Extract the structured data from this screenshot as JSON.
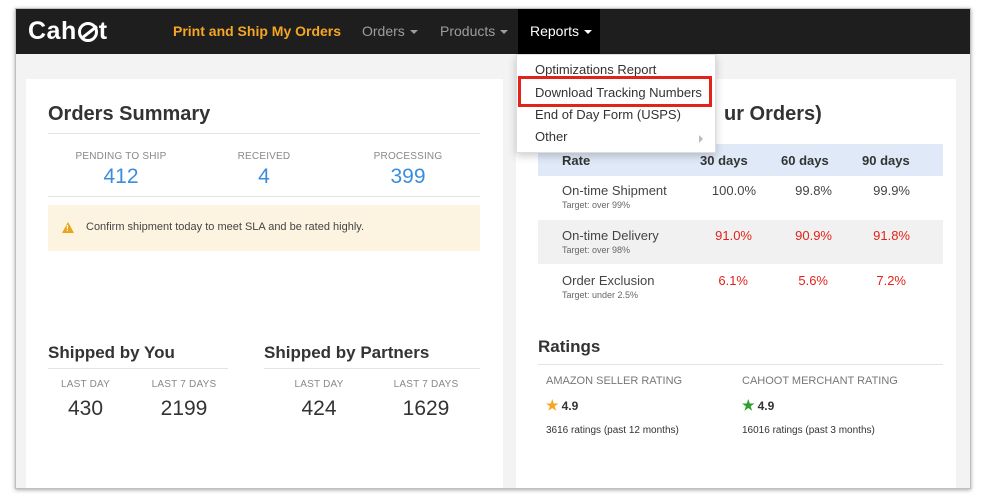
{
  "colors": {
    "navbar_bg": "#1e1e1e",
    "brand_link": "#f5a623",
    "stat_blue": "#3a8dde",
    "alert_bg": "#fcf4e1",
    "bad_red": "#e2231a",
    "table_head_bg": "#dfe9f7",
    "star_orange": "#f5a623",
    "star_green": "#2e9e2e"
  },
  "navbar": {
    "logo": "Cahoot",
    "brand_link": "Print and Ship My Orders",
    "orders": "Orders",
    "products": "Products",
    "reports": "Reports"
  },
  "reports_menu": {
    "items": [
      "Optimizations Report",
      "Download Tracking Numbers",
      "End of Day Form (USPS)",
      "Other"
    ],
    "highlighted": "Download Tracking Numbers"
  },
  "orders_summary": {
    "title": "Orders Summary",
    "stats": [
      {
        "label": "PENDING TO SHIP",
        "value": "412"
      },
      {
        "label": "RECEIVED",
        "value": "4"
      },
      {
        "label": "PROCESSING",
        "value": "399"
      }
    ],
    "alert_icon": "warning-icon",
    "alert": "Confirm shipment today to meet SLA and be rated highly."
  },
  "shipped_by_you": {
    "title": "Shipped by You",
    "stats": [
      {
        "label": "LAST DAY",
        "value": "430"
      },
      {
        "label": "LAST 7 DAYS",
        "value": "2199"
      }
    ]
  },
  "shipped_by_partners": {
    "title": "Shipped by Partners",
    "stats": [
      {
        "label": "LAST DAY",
        "value": "424"
      },
      {
        "label": "LAST 7 DAYS",
        "value": "1629"
      }
    ]
  },
  "performance": {
    "title_visible": "ur Orders)",
    "columns": [
      "Rate",
      "30 days",
      "60 days",
      "90 days"
    ],
    "rows": [
      {
        "label": "On-time Shipment",
        "target": "Target: over 99%",
        "values": [
          "100.0%",
          "99.8%",
          "99.9%"
        ],
        "status": "ok"
      },
      {
        "label": "On-time Delivery",
        "target": "Target: over 98%",
        "values": [
          "91.0%",
          "90.9%",
          "91.8%"
        ],
        "status": "bad"
      },
      {
        "label": "Order Exclusion",
        "target": "Target: under 2.5%",
        "values": [
          "6.1%",
          "5.6%",
          "7.2%"
        ],
        "status": "bad"
      }
    ]
  },
  "ratings": {
    "title": "Ratings",
    "amazon": {
      "label": "AMAZON SELLER RATING",
      "value": "4.9",
      "count": "3616 ratings (past 12 months)",
      "star": "star-icon"
    },
    "cahoot": {
      "label": "CAHOOT MERCHANT RATING",
      "value": "4.9",
      "count": "16016 ratings (past 3 months)",
      "star": "star-icon"
    }
  }
}
